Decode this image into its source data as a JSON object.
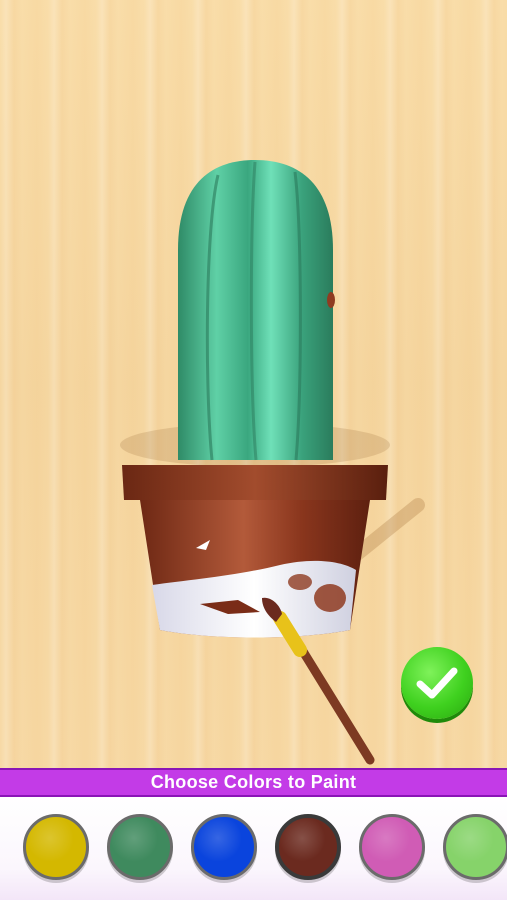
{
  "banner": {
    "text": "Choose Colors to Paint"
  },
  "palette": {
    "swatches": [
      {
        "name": "yellow",
        "color": "#d4b800"
      },
      {
        "name": "green",
        "color": "#3f8a5e"
      },
      {
        "name": "blue",
        "color": "#0a44dd"
      },
      {
        "name": "brown",
        "color": "#6b2a1f",
        "selected": true
      },
      {
        "name": "pink",
        "color": "#d05cb5"
      },
      {
        "name": "light-green",
        "color": "#86d36a"
      }
    ]
  },
  "scene": {
    "cactus_color": "#4fbf98",
    "pot_color": "#8f3b21",
    "pot_unpainted_color": "#f1f1f5",
    "brush_handle_color": "#7d3a22",
    "brush_ferrule_color": "#e8c21a"
  },
  "icons": {
    "confirm": "checkmark-icon"
  }
}
